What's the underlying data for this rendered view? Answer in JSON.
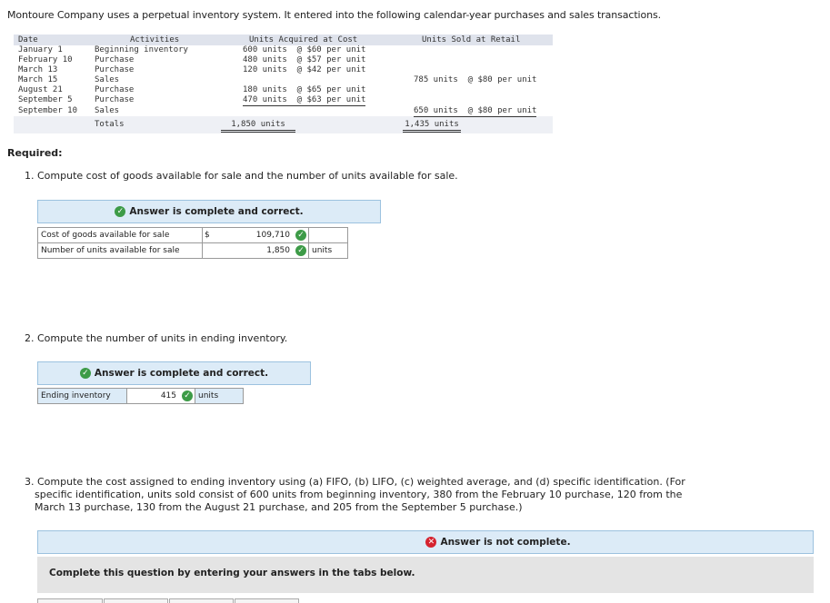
{
  "intro": "Montoure Company uses a perpetual inventory system. It entered into the following calendar-year purchases and sales transactions.",
  "inventory_table": {
    "headers": {
      "date": "Date",
      "activities": "Activities",
      "acquired": "Units Acquired at Cost",
      "sold": "Units Sold at Retail"
    },
    "rows": [
      {
        "date": "January 1",
        "activity": "Beginning inventory",
        "acquired": "600 units  @ $60 per unit",
        "sold": ""
      },
      {
        "date": "February 10",
        "activity": "Purchase",
        "acquired": "480 units  @ $57 per unit",
        "sold": ""
      },
      {
        "date": "March 13",
        "activity": "Purchase",
        "acquired": "120 units  @ $42 per unit",
        "sold": ""
      },
      {
        "date": "March 15",
        "activity": "Sales",
        "acquired": "",
        "sold": "785 units  @ $80 per unit"
      },
      {
        "date": "August 21",
        "activity": "Purchase",
        "acquired": "180 units  @ $65 per unit",
        "sold": ""
      },
      {
        "date": "September 5",
        "activity": "Purchase",
        "acquired": "470 units  @ $63 per unit",
        "sold": ""
      },
      {
        "date": "September 10",
        "activity": "Sales",
        "acquired": "",
        "sold": "650 units  @ $80 per unit"
      }
    ],
    "totals": {
      "label": "Totals",
      "acquired": "1,850 units",
      "sold": "1,435 units"
    }
  },
  "required_label": "Required:",
  "q1": {
    "text": "1. Compute cost of goods available for sale and the number of units available for sale.",
    "banner": "Answer is complete and correct.",
    "rows": [
      {
        "label": "Cost of goods available for sale",
        "prefix": "$",
        "value": "109,710",
        "unit": ""
      },
      {
        "label": "Number of units available for sale",
        "prefix": "",
        "value": "1,850",
        "unit": "units"
      }
    ]
  },
  "q2": {
    "text": "2. Compute the number of units in ending inventory.",
    "banner": "Answer is complete and correct.",
    "row": {
      "label": "Ending inventory",
      "value": "415",
      "unit": "units"
    }
  },
  "q3": {
    "line1": "3. Compute the cost assigned to ending inventory using (a) FIFO, (b) LIFO, (c) weighted average, and (d) specific identification. (For",
    "line2": "specific identification, units sold consist of 600 units from beginning inventory, 380 from the February 10 purchase, 120 from the",
    "line3": "March 13 purchase, 130 from the August 21 purchase, and 205 from the September 5 purchase.)",
    "banner": "Answer is not complete.",
    "instructions": "Complete this question by entering your answers in the tabs below."
  },
  "colors": {
    "banner_bg": "#dcebf7",
    "correct": "#3d9b47",
    "incorrect": "#d5232f"
  },
  "icons": {
    "correct": "check-circle-icon",
    "incorrect": "x-circle-icon"
  }
}
